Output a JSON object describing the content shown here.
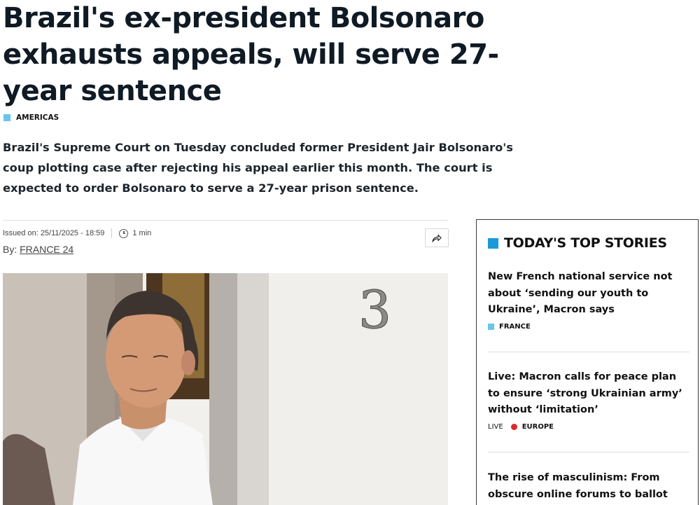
{
  "article": {
    "headline": "Brazil's ex-president Bolsonaro exhausts appeals, will serve 27-year sentence",
    "category": "AMERICAS",
    "lead": "Brazil's Supreme Court on Tuesday concluded former President Jair Bolsonaro's coup plotting case after rejecting his appeal earlier this month. The court is expected to order Bolsonaro to serve a 27-year prison sentence.",
    "issued": "Issued on: 25/11/2025 - 18:59",
    "read_time": "1 min",
    "byline_prefix": "By:",
    "author": "FRANCE 24",
    "photo_number": "3"
  },
  "sidebar": {
    "title": "TODAY'S TOP STORIES",
    "stories": [
      {
        "title": "New French national service not about ‘sending our youth to Ukraine’, Macron says",
        "tag": "FRANCE"
      },
      {
        "title": "Live: Macron calls for peace plan to ensure ‘strong Ukrainian army’ without ‘limitation’",
        "live": "LIVE",
        "tag": "EUROPE"
      },
      {
        "title": "The rise of masculinism: From obscure online forums to ballot"
      }
    ]
  },
  "colors": {
    "accent_light_blue": "#69c5ea",
    "accent_blue": "#1a9ad6",
    "live_red": "#e0262c",
    "headline": "#0f1a24"
  },
  "icons": {
    "clock": "clock-icon",
    "share": "share-icon"
  }
}
